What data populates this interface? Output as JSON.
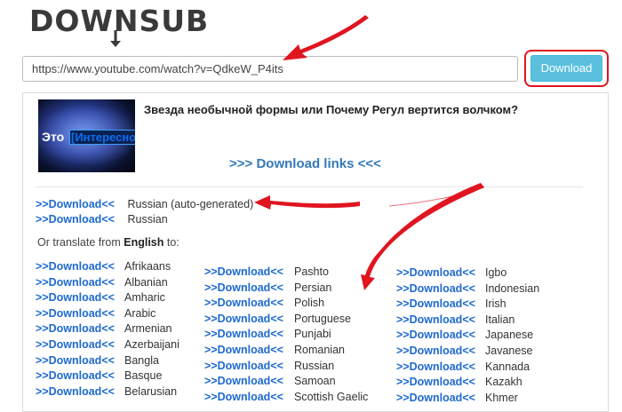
{
  "logo": {
    "text": "DOWNSUB"
  },
  "search": {
    "value": "https://www.youtube.com/watch?v=QdkeW_P4its"
  },
  "button": {
    "label": "Download"
  },
  "video": {
    "title": "Звезда необычной формы или Почему Регул вертится волчком?",
    "thumb_text_1": "Это",
    "thumb_text_2": "[Интересно]"
  },
  "links_heading": ">>> Download links <<<",
  "link_label": ">>Download<<",
  "primary": [
    {
      "lang": "Russian (auto-generated)"
    },
    {
      "lang": "Russian"
    }
  ],
  "translate": {
    "prefix": "Or translate from ",
    "source": "English",
    "suffix": " to:"
  },
  "columns": [
    [
      "Afrikaans",
      "Albanian",
      "Amharic",
      "Arabic",
      "Armenian",
      "Azerbaijani",
      "Bangla",
      "Basque",
      "Belarusian"
    ],
    [
      "Pashto",
      "Persian",
      "Polish",
      "Portuguese",
      "Punjabi",
      "Romanian",
      "Russian",
      "Samoan",
      "Scottish Gaelic"
    ],
    [
      "Igbo",
      "Indonesian",
      "Irish",
      "Italian",
      "Japanese",
      "Javanese",
      "Kannada",
      "Kazakh",
      "Khmer"
    ]
  ],
  "colors": {
    "accent_red": "#e01520",
    "link_blue": "#1e6ad0",
    "button_blue": "#5bc0de"
  }
}
